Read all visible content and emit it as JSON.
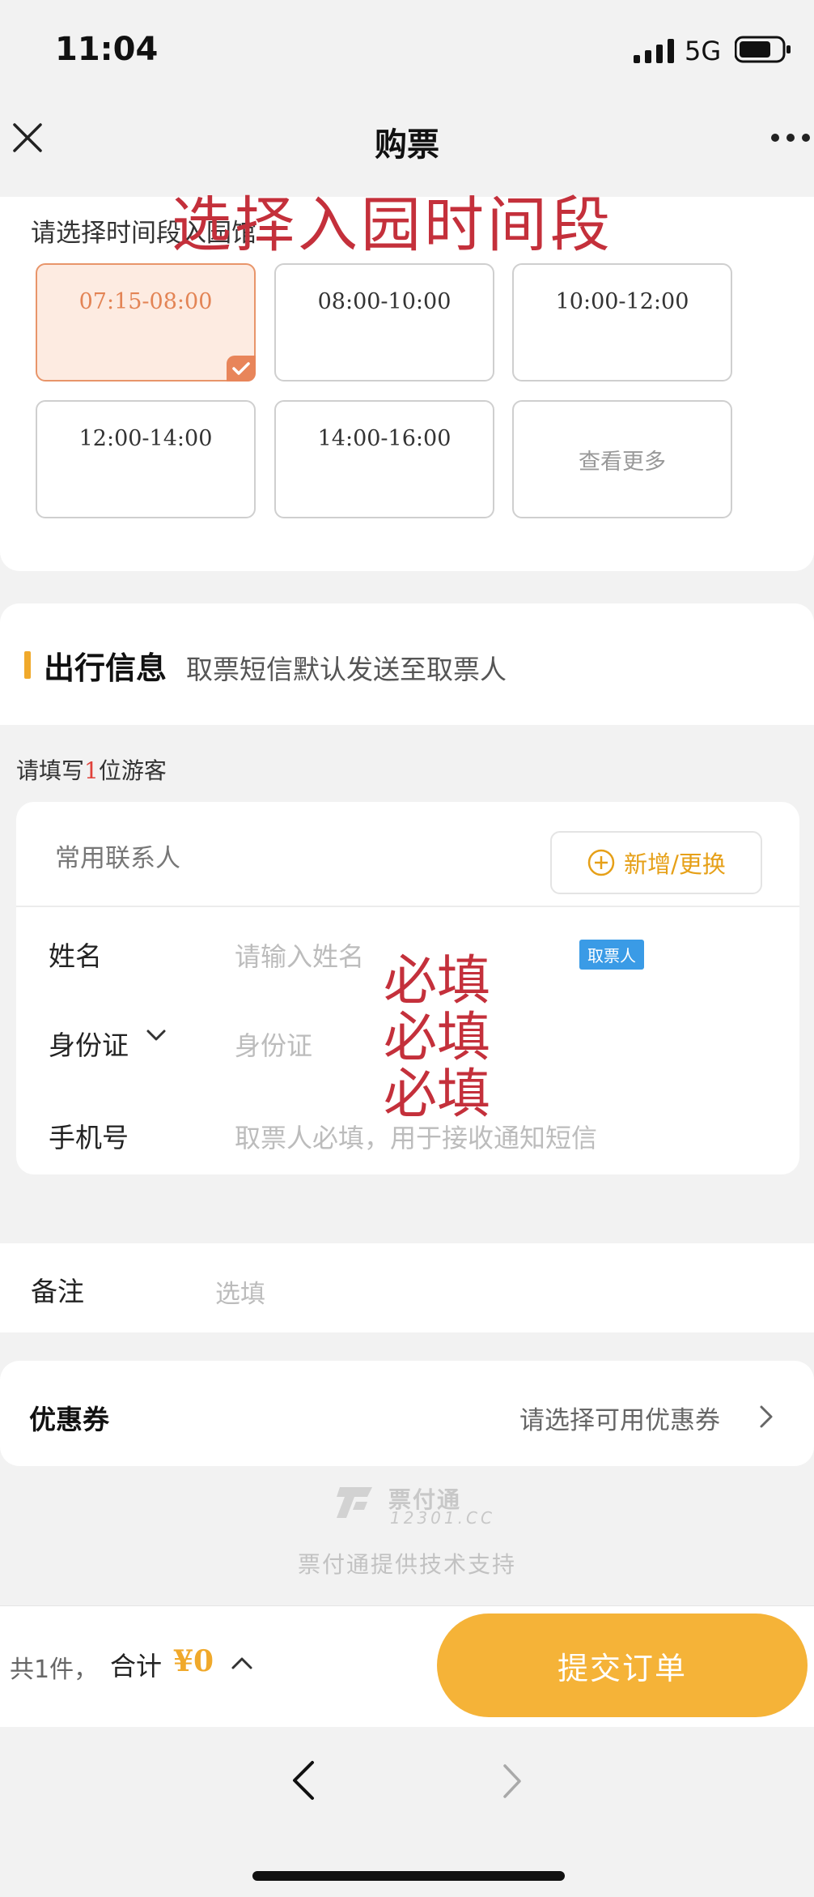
{
  "status_bar": {
    "time": "11:04",
    "network": "5G"
  },
  "nav": {
    "title": "购票"
  },
  "time_slots": {
    "heading": "请选择时间段入园馆",
    "overlay_title": "选择入园时间段",
    "slots": [
      {
        "label": "07:15-08:00",
        "selected": true
      },
      {
        "label": "08:00-10:00",
        "selected": false
      },
      {
        "label": "10:00-12:00",
        "selected": false
      },
      {
        "label": "12:00-14:00",
        "selected": false
      },
      {
        "label": "14:00-16:00",
        "selected": false
      }
    ],
    "more_label": "查看更多"
  },
  "travel_info": {
    "title": "出行信息",
    "subtitle": "取票短信默认发送至取票人",
    "visitor_hint_prefix": "请填写",
    "visitor_count": "1",
    "visitor_hint_suffix": "位游客",
    "contacts_label": "常用联系人",
    "add_button_label": "新增/更换",
    "fields": {
      "name_label": "姓名",
      "name_placeholder": "请输入姓名",
      "pickup_badge": "取票人",
      "id_label": "身份证",
      "id_placeholder": "身份证",
      "phone_label": "手机号",
      "phone_placeholder": "取票人必填，用于接收通知短信"
    },
    "required_notes": [
      "必填",
      "必填",
      "必填"
    ]
  },
  "remarks": {
    "label": "备注",
    "placeholder": "选填"
  },
  "coupon": {
    "label": "优惠券",
    "link_text": "请选择可用优惠券"
  },
  "footer": {
    "logo_name": "票付通",
    "logo_site": "12301.CC",
    "support_text": "票付通提供技术支持"
  },
  "order_bar": {
    "count_text": "共1件，",
    "total_label": "合计",
    "total_value": "¥0",
    "submit_label": "提交订单"
  },
  "colors": {
    "accent": "#f5b338",
    "selected_slot": "#e8855a",
    "overlay_red": "#c4303b",
    "badge_blue": "#3a9be6"
  }
}
